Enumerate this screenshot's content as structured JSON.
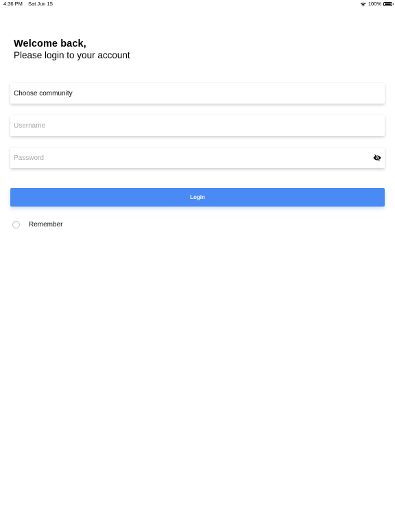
{
  "status_bar": {
    "time": "4:36 PM",
    "date": "Sat Jun 15",
    "battery": "100%",
    "battery_level": 1.0
  },
  "header": {
    "title": "Welcome back,",
    "subtitle": "Please login to your account"
  },
  "form": {
    "community": {
      "value": "Choose community"
    },
    "username": {
      "value": "",
      "placeholder": "Username"
    },
    "password": {
      "value": "",
      "placeholder": "Password"
    },
    "login_label": "Login",
    "remember_label": "Remember",
    "remember_checked": false
  },
  "colors": {
    "accent": "#4a8af4",
    "background": "#ffffff",
    "placeholder": "#a9a9a9"
  },
  "icons": {
    "wifi": "wifi-icon",
    "battery": "battery-icon",
    "eye": "eye-slash-icon",
    "radio": "radio-unchecked-icon"
  }
}
